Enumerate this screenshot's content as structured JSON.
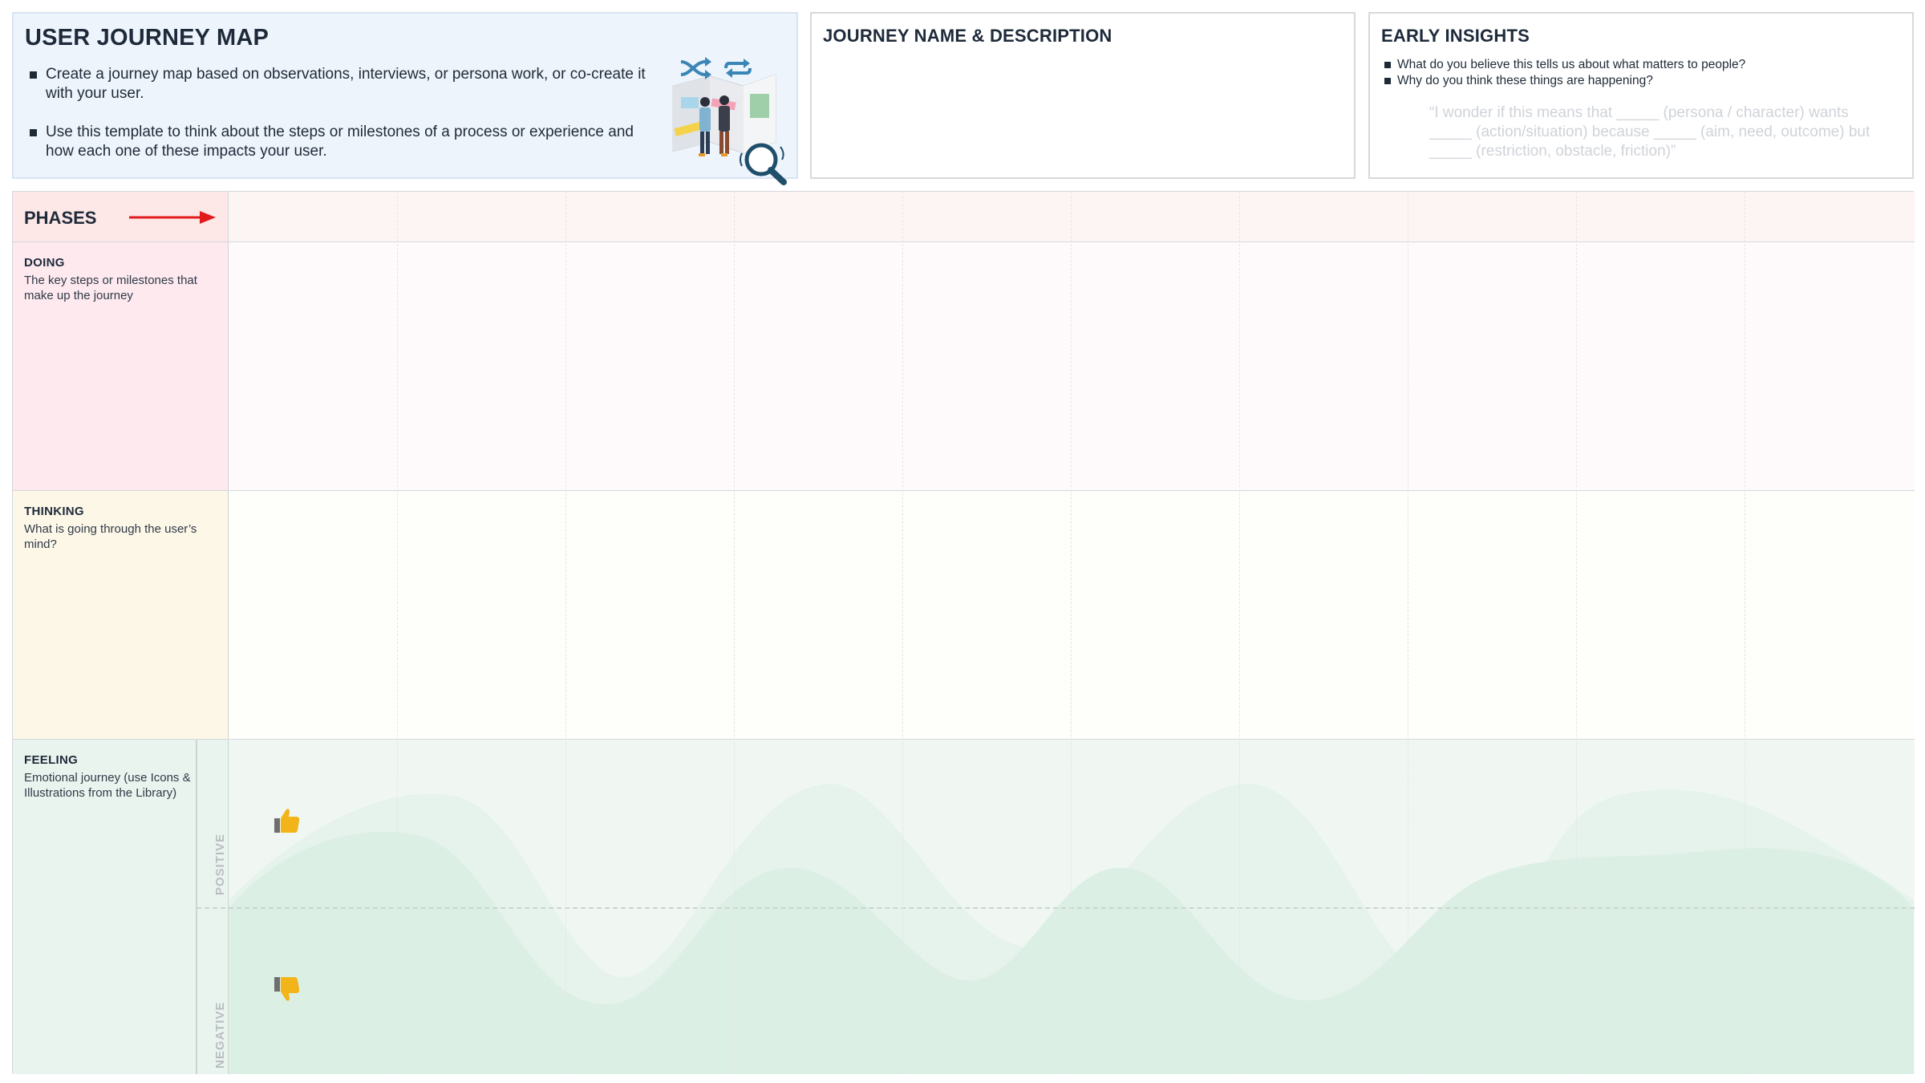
{
  "intro": {
    "title": "USER JOURNEY MAP",
    "bullets": [
      "Create a journey map based on observations, interviews, or persona work, or co-create it with your user.",
      "Use this template to think about the steps or milestones of a process or experience and how each one of these impacts your user."
    ]
  },
  "journey": {
    "title": "JOURNEY NAME & DESCRIPTION"
  },
  "insights": {
    "title": "EARLY INSIGHTS",
    "bullets": [
      "What do you believe this tells us about what matters to people?",
      "Why do you think these things are happening?"
    ],
    "quote": "“I wonder if this means that _____ (persona / character) wants _____ (action/situation) because _____ (aim, need, outcome) but _____ (restriction, obstacle, friction)”"
  },
  "rows": {
    "phases": {
      "title": "PHASES"
    },
    "doing": {
      "title": "DOING",
      "desc": "The key steps or milestones that make up the journey"
    },
    "thinking": {
      "title": "THINKING",
      "desc": "What is going through the user’s mind?"
    },
    "feeling": {
      "title": "FEELING",
      "desc": "Emotional journey (use Icons & Illustrations from the Library)"
    }
  },
  "axis": {
    "positive": "POSITIVE",
    "negative": "NEGATIVE"
  },
  "colors": {
    "arrow": "#e11b1b",
    "thumb": "#f2b418",
    "wave_light": "#e6f2ec",
    "wave_dark": "#dcefe5"
  },
  "icons": [
    "map-illustration",
    "shuffle-icon",
    "repeat-icon",
    "magnifier-icon",
    "arrow-right-icon",
    "thumbs-up-icon",
    "thumbs-down-icon"
  ]
}
